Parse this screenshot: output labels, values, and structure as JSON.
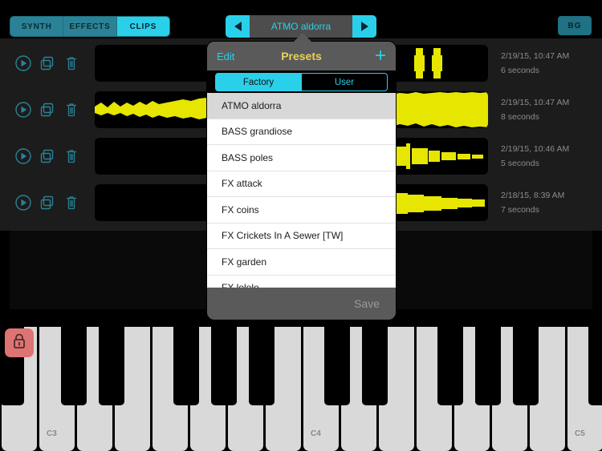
{
  "topbar": {
    "segments": [
      {
        "label": "SYNTH",
        "active": false
      },
      {
        "label": "EFFECTS",
        "active": false
      },
      {
        "label": "CLIPS",
        "active": true
      }
    ],
    "preset_nav": {
      "prev_icon": "triangle-left-icon",
      "next_icon": "triangle-right-icon",
      "current_preset": "ATMO aldorra"
    },
    "bg_button": "BG"
  },
  "clips": [
    {
      "date": "2/19/15, 10:47 AM",
      "duration": "6 seconds"
    },
    {
      "date": "2/19/15, 10:47 AM",
      "duration": "8 seconds"
    },
    {
      "date": "2/19/15, 10:46 AM",
      "duration": "5 seconds"
    },
    {
      "date": "2/18/15, 8:39 AM",
      "duration": "7 seconds"
    }
  ],
  "clip_row_icons": [
    "play-icon",
    "duplicate-icon",
    "trash-icon"
  ],
  "presets_popover": {
    "edit_label": "Edit",
    "title": "Presets",
    "add_label": "+",
    "tabs": [
      {
        "label": "Factory",
        "active": true
      },
      {
        "label": "User",
        "active": false
      }
    ],
    "items": [
      {
        "name": "ATMO aldorra",
        "selected": true
      },
      {
        "name": "BASS grandiose",
        "selected": false
      },
      {
        "name": "BASS poles",
        "selected": false
      },
      {
        "name": "FX attack",
        "selected": false
      },
      {
        "name": "FX coins",
        "selected": false
      },
      {
        "name": "FX Crickets In A Sewer [TW]",
        "selected": false
      },
      {
        "name": "FX garden",
        "selected": false
      },
      {
        "name": "FX lololo",
        "selected": false
      }
    ],
    "save_label": "Save"
  },
  "keyboard": {
    "lock_icon": "lock-icon",
    "key_labels": [
      "C3",
      "C4",
      "C5"
    ]
  },
  "colors": {
    "accent_cyan": "#2ad0ea",
    "teal_dim": "#2b8296",
    "waveform_yellow": "#e6e600",
    "title_gold": "#e8d25a",
    "lock_red": "#dd7373"
  }
}
